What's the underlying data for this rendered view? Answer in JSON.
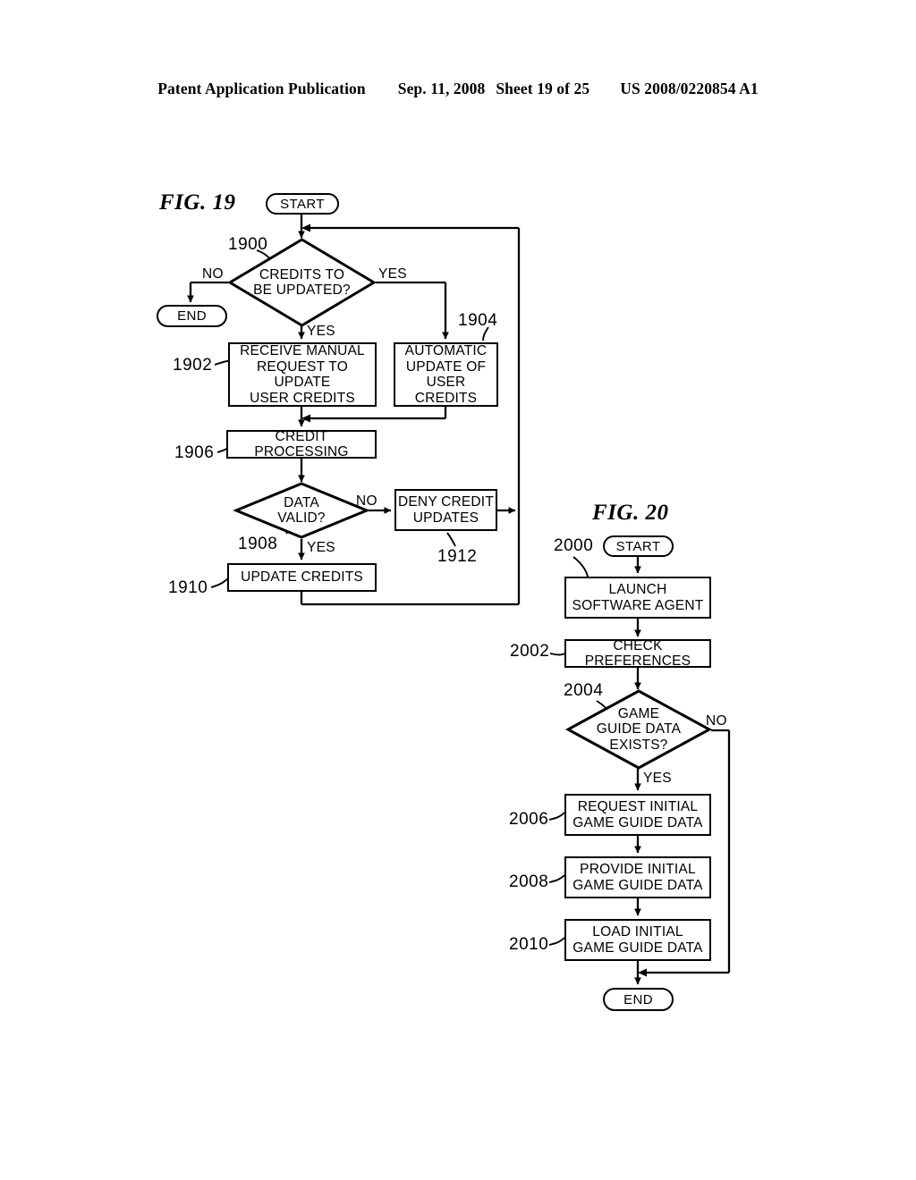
{
  "header": {
    "publication": "Patent Application Publication",
    "date": "Sep. 11, 2008",
    "sheet": "Sheet 19 of 25",
    "docnum": "US 2008/0220854 A1"
  },
  "fig19": {
    "label": "FIG. 19",
    "start": "START",
    "end": "END",
    "decision_1900": "CREDITS TO\nBE UPDATED?",
    "decision_1900_line1": "CREDITS TO",
    "decision_1900_line2": "BE UPDATED?",
    "box_1902_line1": "RECEIVE MANUAL",
    "box_1902_line2": "REQUEST TO UPDATE",
    "box_1902_line3": "USER CREDITS",
    "box_1904_line1": "AUTOMATIC",
    "box_1904_line2": "UPDATE OF",
    "box_1904_line3": "USER CREDITS",
    "box_1906": "CREDIT PROCESSING",
    "decision_1908_line1": "DATA",
    "decision_1908_line2": "VALID?",
    "box_1910": "UPDATE CREDITS",
    "box_1912_line1": "DENY CREDIT",
    "box_1912_line2": "UPDATES",
    "refs": {
      "r1900": "1900",
      "r1902": "1902",
      "r1904": "1904",
      "r1906": "1906",
      "r1908": "1908",
      "r1910": "1910",
      "r1912": "1912"
    },
    "branches": {
      "no_to_end": "NO",
      "yes_right": "YES",
      "yes_down": "YES",
      "valid_no": "NO",
      "valid_yes": "YES"
    }
  },
  "fig20": {
    "label": "FIG. 20",
    "start": "START",
    "end": "END",
    "box_2000_line1": "LAUNCH",
    "box_2000_line2": "SOFTWARE AGENT",
    "box_2002": "CHECK PREFERENCES",
    "decision_2004_line1": "GAME",
    "decision_2004_line2": "GUIDE DATA",
    "decision_2004_line3": "EXISTS?",
    "box_2006_line1": "REQUEST INITIAL",
    "box_2006_line2": "GAME GUIDE DATA",
    "box_2008_line1": "PROVIDE INITIAL",
    "box_2008_line2": "GAME GUIDE DATA",
    "box_2010_line1": "LOAD INITIAL",
    "box_2010_line2": "GAME GUIDE DATA",
    "refs": {
      "r2000": "2000",
      "r2002": "2002",
      "r2004": "2004",
      "r2006": "2006",
      "r2008": "2008",
      "r2010": "2010"
    },
    "branches": {
      "exists_no": "NO",
      "exists_yes": "YES"
    }
  }
}
